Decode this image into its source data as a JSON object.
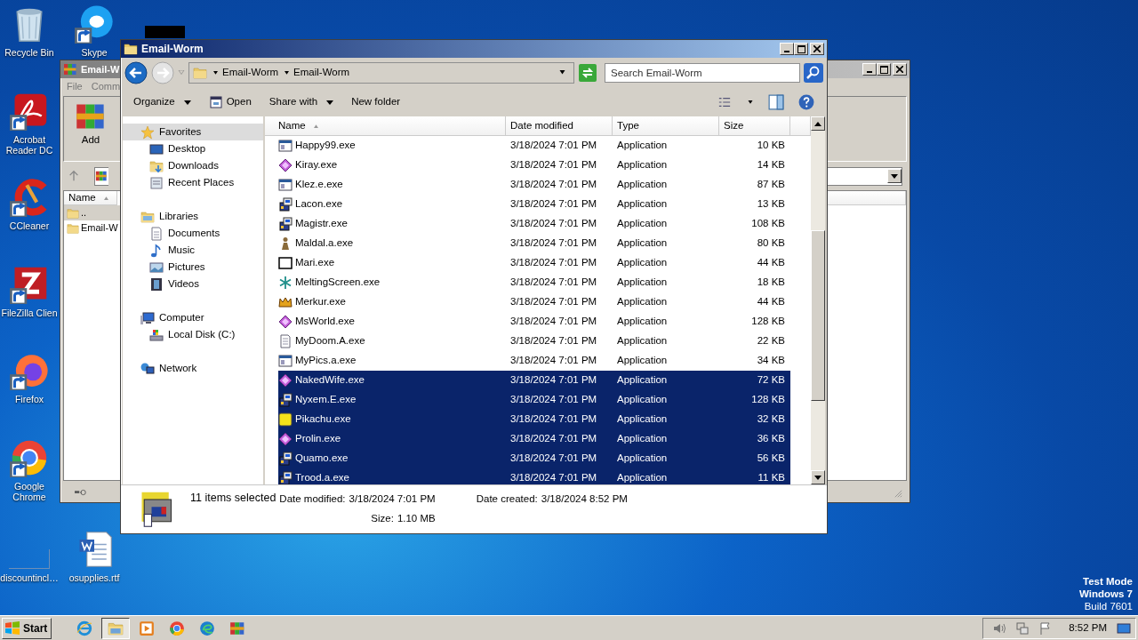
{
  "desktop_icons": [
    {
      "label": "Recycle Bin",
      "kind": "recycle",
      "shortcut": false
    },
    {
      "label": "Skype",
      "kind": "skype",
      "shortcut": true
    },
    {
      "label": "Acrobat Reader DC",
      "kind": "acrobat",
      "shortcut": true
    },
    {
      "label": "CCleaner",
      "kind": "ccleaner",
      "shortcut": true
    },
    {
      "label": "FileZilla Clien",
      "kind": "filezilla",
      "shortcut": true
    },
    {
      "label": "Firefox",
      "kind": "firefox",
      "shortcut": true
    },
    {
      "label": "Google Chrome",
      "kind": "chrome",
      "shortcut": true
    },
    {
      "label": "discountincl…",
      "kind": "blank"
    },
    {
      "label": "osupplies.rtf",
      "kind": "word",
      "shortcut": false
    }
  ],
  "background_window": {
    "title": "Email-W",
    "menu": [
      "File",
      "Comm"
    ],
    "toolbar_button": "Add",
    "column": "Name",
    "items": [
      {
        "label": "..",
        "selected": true
      },
      {
        "label": "Email-W",
        "selected": false
      }
    ]
  },
  "explorer": {
    "title": "Email-Worm",
    "breadcrumb": [
      "Email-Worm",
      "Email-Worm"
    ],
    "search": {
      "placeholder": "Search Email-Worm"
    },
    "commands": [
      {
        "label": "Organize",
        "kind": "menu"
      },
      {
        "label": "Open",
        "kind": "icon"
      },
      {
        "label": "Share with",
        "kind": "menu"
      },
      {
        "label": "New folder",
        "kind": "plain"
      }
    ],
    "nav": [
      {
        "label": "Favorites",
        "kind": "star",
        "selected": true,
        "children": [
          {
            "label": "Desktop",
            "kind": "desktop",
            "selected": false
          },
          {
            "label": "Downloads",
            "kind": "downloads",
            "selected": false
          },
          {
            "label": "Recent Places",
            "kind": "recent",
            "selected": false
          }
        ]
      },
      {
        "label": "Libraries",
        "kind": "libraries",
        "selected": false,
        "children": [
          {
            "label": "Documents",
            "kind": "documents",
            "selected": false
          },
          {
            "label": "Music",
            "kind": "music",
            "selected": false
          },
          {
            "label": "Pictures",
            "kind": "pictures",
            "selected": false
          },
          {
            "label": "Videos",
            "kind": "videos",
            "selected": false
          }
        ]
      },
      {
        "label": "Computer",
        "kind": "computer",
        "selected": false,
        "children": [
          {
            "label": "Local Disk (C:)",
            "kind": "disk",
            "selected": false
          }
        ]
      },
      {
        "label": "Network",
        "kind": "network",
        "selected": false
      }
    ],
    "columns": [
      "Name",
      "Date modified",
      "Type",
      "Size"
    ],
    "rows": [
      {
        "name": "Happy99.exe",
        "kind": "window",
        "date": "3/18/2024 7:01 PM",
        "type": "Application",
        "size": "10 KB",
        "selected": false
      },
      {
        "name": "Kiray.exe",
        "kind": "diamond",
        "date": "3/18/2024 7:01 PM",
        "type": "Application",
        "size": "14 KB",
        "selected": false
      },
      {
        "name": "Klez.e.exe",
        "kind": "window",
        "date": "3/18/2024 7:01 PM",
        "type": "Application",
        "size": "87 KB",
        "selected": false
      },
      {
        "name": "Lacon.exe",
        "kind": "installer",
        "date": "3/18/2024 7:01 PM",
        "type": "Application",
        "size": "13 KB",
        "selected": false
      },
      {
        "name": "Magistr.exe",
        "kind": "installer",
        "date": "3/18/2024 7:01 PM",
        "type": "Application",
        "size": "108 KB",
        "selected": false
      },
      {
        "name": "Maldal.a.exe",
        "kind": "figure",
        "date": "3/18/2024 7:01 PM",
        "type": "Application",
        "size": "80 KB",
        "selected": false
      },
      {
        "name": "Mari.exe",
        "kind": "frame",
        "date": "3/18/2024 7:01 PM",
        "type": "Application",
        "size": "44 KB",
        "selected": false
      },
      {
        "name": "MeltingScreen.exe",
        "kind": "snowflake",
        "date": "3/18/2024 7:01 PM",
        "type": "Application",
        "size": "18 KB",
        "selected": false
      },
      {
        "name": "Merkur.exe",
        "kind": "crown",
        "date": "3/18/2024 7:01 PM",
        "type": "Application",
        "size": "44 KB",
        "selected": false
      },
      {
        "name": "MsWorld.exe",
        "kind": "diamond",
        "date": "3/18/2024 7:01 PM",
        "type": "Application",
        "size": "128 KB",
        "selected": false
      },
      {
        "name": "MyDoom.A.exe",
        "kind": "document",
        "date": "3/18/2024 7:01 PM",
        "type": "Application",
        "size": "22 KB",
        "selected": false
      },
      {
        "name": "MyPics.a.exe",
        "kind": "window",
        "date": "3/18/2024 7:01 PM",
        "type": "Application",
        "size": "34 KB",
        "selected": false
      },
      {
        "name": "NakedWife.exe",
        "kind": "diamond",
        "date": "3/18/2024 7:01 PM",
        "type": "Application",
        "size": "72 KB",
        "selected": true
      },
      {
        "name": "Nyxem.E.exe",
        "kind": "installer",
        "date": "3/18/2024 7:01 PM",
        "type": "Application",
        "size": "128 KB",
        "selected": true
      },
      {
        "name": "Pikachu.exe",
        "kind": "tile",
        "date": "3/18/2024 7:01 PM",
        "type": "Application",
        "size": "32 KB",
        "selected": true
      },
      {
        "name": "Prolin.exe",
        "kind": "diamond",
        "date": "3/18/2024 7:01 PM",
        "type": "Application",
        "size": "36 KB",
        "selected": true
      },
      {
        "name": "Quamo.exe",
        "kind": "installer",
        "date": "3/18/2024 7:01 PM",
        "type": "Application",
        "size": "56 KB",
        "selected": true
      },
      {
        "name": "Trood.a.exe",
        "kind": "installer",
        "date": "3/18/2024 7:01 PM",
        "type": "Application",
        "size": "11 KB",
        "selected": true
      }
    ],
    "details": {
      "count": "11 items selected",
      "fields": [
        {
          "label": "Date modified:",
          "value": "3/18/2024 7:01 PM"
        },
        {
          "label": "Date created:",
          "value": "3/18/2024 8:52 PM"
        },
        {
          "label": "Size:",
          "value": "1.10 MB"
        }
      ]
    }
  },
  "taskbar": {
    "start": "Start",
    "apps": [
      {
        "kind": "ie",
        "active": false
      },
      {
        "kind": "explorer",
        "active": true
      },
      {
        "kind": "media",
        "active": false
      },
      {
        "kind": "chrome",
        "active": false
      },
      {
        "kind": "edge",
        "active": false
      },
      {
        "kind": "winrar",
        "active": false
      }
    ],
    "clock": "8:52 PM"
  },
  "os_notice": [
    "Test Mode",
    "Windows 7",
    "Build 7601"
  ]
}
